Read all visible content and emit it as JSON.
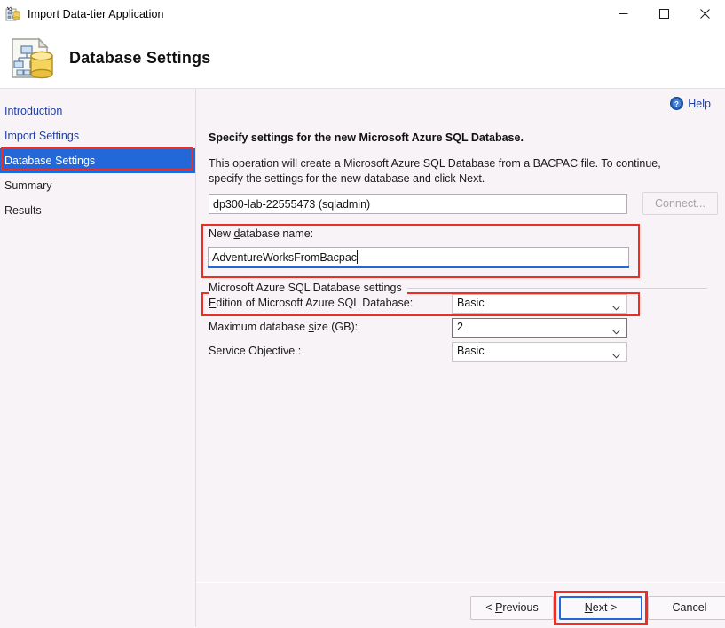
{
  "window": {
    "title": "Import Data-tier Application",
    "icon": "datatier-app-icon",
    "controls": {
      "minimize": "minimize-icon",
      "maximize": "maximize-icon",
      "close": "close-icon"
    }
  },
  "header": {
    "title": "Database Settings",
    "icon": "database-schema-icon"
  },
  "sidebar": {
    "items": [
      {
        "label": "Introduction",
        "state": "done"
      },
      {
        "label": "Import Settings",
        "state": "done"
      },
      {
        "label": "Database Settings",
        "state": "selected"
      },
      {
        "label": "Summary",
        "state": "future"
      },
      {
        "label": "Results",
        "state": "future"
      }
    ]
  },
  "content": {
    "help": {
      "label": "Help",
      "icon": "help-circle-icon"
    },
    "intro_title": "Specify settings for the new Microsoft Azure SQL Database.",
    "intro_body": "This operation will create a Microsoft Azure SQL Database from a BACPAC file. To continue, specify the settings for the new database and click Next.",
    "server": {
      "value": "dp300-lab-22555473 (sqladmin)",
      "connect_label": "Connect...",
      "connect_enabled": false
    },
    "database_name": {
      "label_pre": "New ",
      "label_key": "d",
      "label_post": "atabase name:",
      "value": "AdventureWorksFromBacpac",
      "focused": true
    },
    "groupbox_label": "Microsoft Azure SQL Database settings",
    "fields": [
      {
        "label_pre": "",
        "label_key": "E",
        "label_post": "dition of Microsoft Azure SQL Database:",
        "value": "Basic",
        "hover": false,
        "name": "edition"
      },
      {
        "label_pre": "Maximum database ",
        "label_key": "s",
        "label_post": "ize (GB):",
        "value": "2",
        "hover": true,
        "name": "max-size"
      },
      {
        "label_pre": "Service Objective :",
        "label_key": "",
        "label_post": "",
        "value": "Basic",
        "hover": false,
        "name": "service-objective"
      }
    ]
  },
  "footer": {
    "previous": {
      "pre": "< ",
      "key": "P",
      "post": "revious"
    },
    "next": {
      "pre": "",
      "key": "N",
      "post": "ext >"
    },
    "cancel": {
      "pre": "Cancel",
      "key": "",
      "post": ""
    }
  },
  "colors": {
    "accent": "#2368d8",
    "annotation": "#ee2d24",
    "link": "#1f3f9e",
    "panel": "#f7f3f7"
  }
}
